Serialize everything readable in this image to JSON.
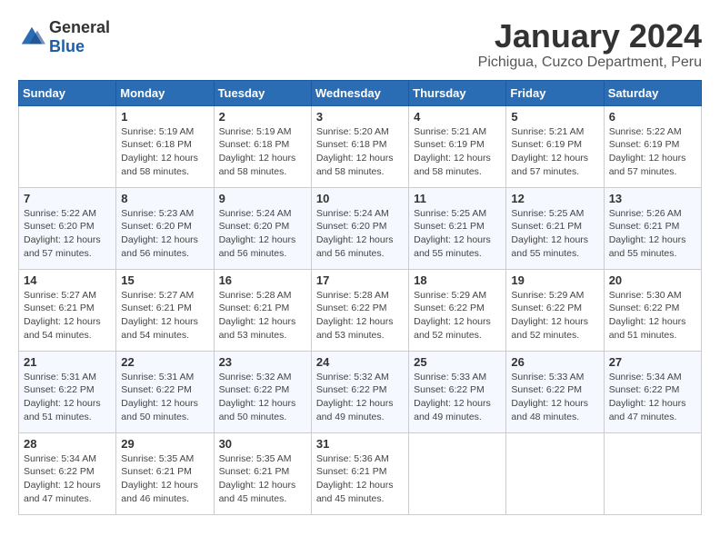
{
  "logo": {
    "text_general": "General",
    "text_blue": "Blue"
  },
  "header": {
    "month_year": "January 2024",
    "location": "Pichigua, Cuzco Department, Peru"
  },
  "weekdays": [
    "Sunday",
    "Monday",
    "Tuesday",
    "Wednesday",
    "Thursday",
    "Friday",
    "Saturday"
  ],
  "weeks": [
    [
      {
        "day": "",
        "info": ""
      },
      {
        "day": "1",
        "info": "Sunrise: 5:19 AM\nSunset: 6:18 PM\nDaylight: 12 hours\nand 58 minutes."
      },
      {
        "day": "2",
        "info": "Sunrise: 5:19 AM\nSunset: 6:18 PM\nDaylight: 12 hours\nand 58 minutes."
      },
      {
        "day": "3",
        "info": "Sunrise: 5:20 AM\nSunset: 6:18 PM\nDaylight: 12 hours\nand 58 minutes."
      },
      {
        "day": "4",
        "info": "Sunrise: 5:21 AM\nSunset: 6:19 PM\nDaylight: 12 hours\nand 58 minutes."
      },
      {
        "day": "5",
        "info": "Sunrise: 5:21 AM\nSunset: 6:19 PM\nDaylight: 12 hours\nand 57 minutes."
      },
      {
        "day": "6",
        "info": "Sunrise: 5:22 AM\nSunset: 6:19 PM\nDaylight: 12 hours\nand 57 minutes."
      }
    ],
    [
      {
        "day": "7",
        "info": "Sunrise: 5:22 AM\nSunset: 6:20 PM\nDaylight: 12 hours\nand 57 minutes."
      },
      {
        "day": "8",
        "info": "Sunrise: 5:23 AM\nSunset: 6:20 PM\nDaylight: 12 hours\nand 56 minutes."
      },
      {
        "day": "9",
        "info": "Sunrise: 5:24 AM\nSunset: 6:20 PM\nDaylight: 12 hours\nand 56 minutes."
      },
      {
        "day": "10",
        "info": "Sunrise: 5:24 AM\nSunset: 6:20 PM\nDaylight: 12 hours\nand 56 minutes."
      },
      {
        "day": "11",
        "info": "Sunrise: 5:25 AM\nSunset: 6:21 PM\nDaylight: 12 hours\nand 55 minutes."
      },
      {
        "day": "12",
        "info": "Sunrise: 5:25 AM\nSunset: 6:21 PM\nDaylight: 12 hours\nand 55 minutes."
      },
      {
        "day": "13",
        "info": "Sunrise: 5:26 AM\nSunset: 6:21 PM\nDaylight: 12 hours\nand 55 minutes."
      }
    ],
    [
      {
        "day": "14",
        "info": "Sunrise: 5:27 AM\nSunset: 6:21 PM\nDaylight: 12 hours\nand 54 minutes."
      },
      {
        "day": "15",
        "info": "Sunrise: 5:27 AM\nSunset: 6:21 PM\nDaylight: 12 hours\nand 54 minutes."
      },
      {
        "day": "16",
        "info": "Sunrise: 5:28 AM\nSunset: 6:21 PM\nDaylight: 12 hours\nand 53 minutes."
      },
      {
        "day": "17",
        "info": "Sunrise: 5:28 AM\nSunset: 6:22 PM\nDaylight: 12 hours\nand 53 minutes."
      },
      {
        "day": "18",
        "info": "Sunrise: 5:29 AM\nSunset: 6:22 PM\nDaylight: 12 hours\nand 52 minutes."
      },
      {
        "day": "19",
        "info": "Sunrise: 5:29 AM\nSunset: 6:22 PM\nDaylight: 12 hours\nand 52 minutes."
      },
      {
        "day": "20",
        "info": "Sunrise: 5:30 AM\nSunset: 6:22 PM\nDaylight: 12 hours\nand 51 minutes."
      }
    ],
    [
      {
        "day": "21",
        "info": "Sunrise: 5:31 AM\nSunset: 6:22 PM\nDaylight: 12 hours\nand 51 minutes."
      },
      {
        "day": "22",
        "info": "Sunrise: 5:31 AM\nSunset: 6:22 PM\nDaylight: 12 hours\nand 50 minutes."
      },
      {
        "day": "23",
        "info": "Sunrise: 5:32 AM\nSunset: 6:22 PM\nDaylight: 12 hours\nand 50 minutes."
      },
      {
        "day": "24",
        "info": "Sunrise: 5:32 AM\nSunset: 6:22 PM\nDaylight: 12 hours\nand 49 minutes."
      },
      {
        "day": "25",
        "info": "Sunrise: 5:33 AM\nSunset: 6:22 PM\nDaylight: 12 hours\nand 49 minutes."
      },
      {
        "day": "26",
        "info": "Sunrise: 5:33 AM\nSunset: 6:22 PM\nDaylight: 12 hours\nand 48 minutes."
      },
      {
        "day": "27",
        "info": "Sunrise: 5:34 AM\nSunset: 6:22 PM\nDaylight: 12 hours\nand 47 minutes."
      }
    ],
    [
      {
        "day": "28",
        "info": "Sunrise: 5:34 AM\nSunset: 6:22 PM\nDaylight: 12 hours\nand 47 minutes."
      },
      {
        "day": "29",
        "info": "Sunrise: 5:35 AM\nSunset: 6:21 PM\nDaylight: 12 hours\nand 46 minutes."
      },
      {
        "day": "30",
        "info": "Sunrise: 5:35 AM\nSunset: 6:21 PM\nDaylight: 12 hours\nand 45 minutes."
      },
      {
        "day": "31",
        "info": "Sunrise: 5:36 AM\nSunset: 6:21 PM\nDaylight: 12 hours\nand 45 minutes."
      },
      {
        "day": "",
        "info": ""
      },
      {
        "day": "",
        "info": ""
      },
      {
        "day": "",
        "info": ""
      }
    ]
  ]
}
